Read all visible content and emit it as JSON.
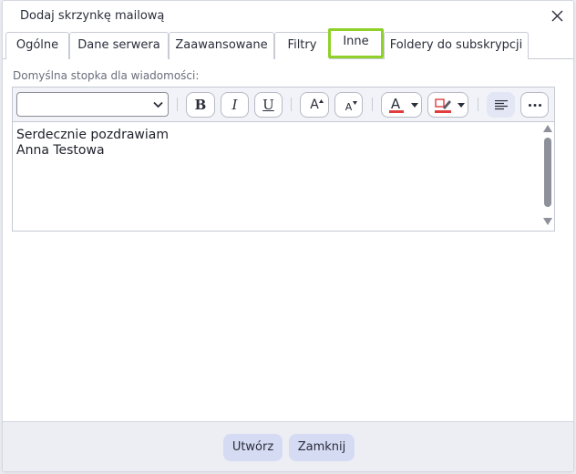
{
  "dialog": {
    "title": "Dodaj skrzynkę mailową"
  },
  "tabs": [
    {
      "label": "Ogólne",
      "active": false
    },
    {
      "label": "Dane serwera",
      "active": false
    },
    {
      "label": "Zaawansowane",
      "active": false
    },
    {
      "label": "Filtry",
      "active": false
    },
    {
      "label": "Inne",
      "active": true
    },
    {
      "label": "Foldery do subskrypcji",
      "active": false
    }
  ],
  "signature": {
    "label": "Domyślna stopka dla wiadomości:",
    "font_value": "",
    "lines": [
      "Serdecznie pozdrawiam",
      "Anna Testowa"
    ]
  },
  "toolbar": {
    "bold": "B",
    "italic": "I",
    "underline": "U",
    "grow": "A",
    "shrink": "A",
    "text_color": "A"
  },
  "footer": {
    "create_label": "Utwórz",
    "close_label": "Zamknij"
  },
  "colors": {
    "accent": "#8fd12a",
    "button_bg": "#d6dbf4",
    "text_color_mark": "#e03c3c"
  },
  "icons": [
    "close-icon",
    "chevron-down-icon",
    "text-color-icon",
    "highlight-color-icon",
    "align-left-icon",
    "more-icon"
  ]
}
